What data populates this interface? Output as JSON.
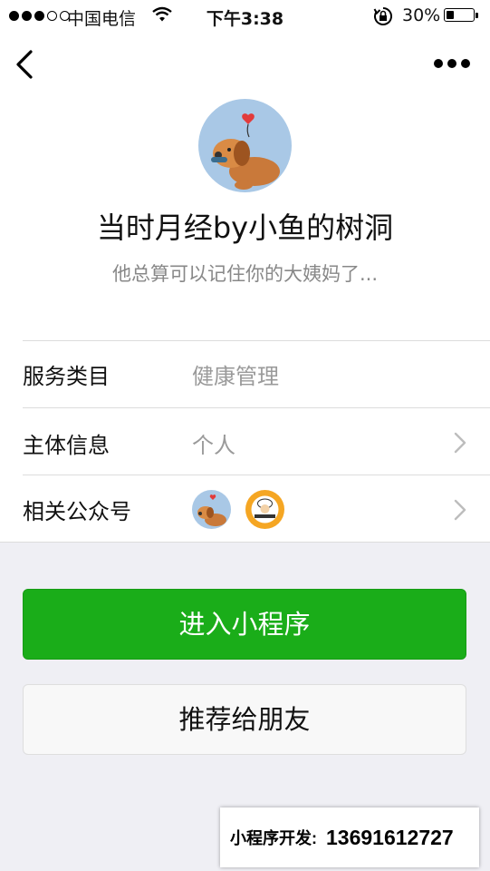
{
  "status_bar": {
    "carrier": "中国电信",
    "time": "下午3:38",
    "battery": "30%",
    "battery_level": 0.3
  },
  "profile": {
    "name": "当时月经by小鱼的树洞",
    "description": "他总算可以记住你的大姨妈了..."
  },
  "info_rows": [
    {
      "label": "服务类目",
      "value": "健康管理"
    },
    {
      "label": "主体信息",
      "value": "个人"
    },
    {
      "label": "相关公众号",
      "value": ""
    }
  ],
  "buttons": {
    "primary": "进入小程序",
    "secondary": "推荐给朋友"
  },
  "developer_label": {
    "prefix": "小程序开发:",
    "phone": "13691612727"
  },
  "colors": {
    "primary_green": "#1aad19",
    "background": "#efeff4"
  }
}
